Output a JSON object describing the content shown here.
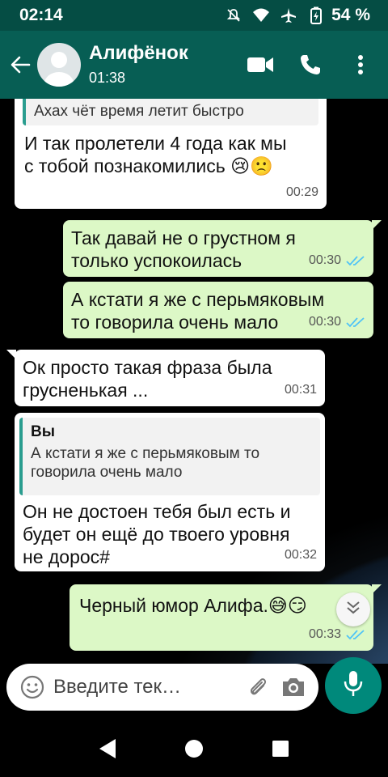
{
  "status_bar": {
    "time": "02:14",
    "battery": "54 %",
    "icons": [
      "mute-icon",
      "wifi-icon",
      "airplane-icon",
      "battery-icon"
    ]
  },
  "header": {
    "contact_name": "Алифёнок",
    "last_seen": "01:38",
    "icons": [
      "back-arrow-icon",
      "video-call-icon",
      "phone-icon",
      "more-vert-icon"
    ]
  },
  "messages": [
    {
      "direction": "in",
      "quote_text": "Ахах чёт время летит быстро",
      "line1": "И так пролетели 4 года как мы",
      "line2": "с тобой познакомились",
      "emoji": "😢🙁",
      "time": "00:29"
    },
    {
      "direction": "out",
      "line1": "Так давай не о грустном я",
      "line2": "только успокоилась",
      "time": "00:30",
      "status": "read"
    },
    {
      "direction": "out",
      "line1": "А кстати я же с перьмяковым",
      "line2": "то говорила очень мало",
      "time": "00:30",
      "status": "read"
    },
    {
      "direction": "in",
      "line1": "Ок просто такая фраза была",
      "line2": "грусненькая ...",
      "time": "00:31"
    },
    {
      "direction": "in",
      "quote_author": "Вы",
      "quote_line1": "А кстати я же с перьмяковым то",
      "quote_line2": "говорила очень мало",
      "line1": "Он не достоен тебя был есть и",
      "line2": "будет он ещё до твоего уровня",
      "line3": "не дорос#",
      "time": "00:32"
    },
    {
      "direction": "out",
      "line1": "Черный юмор Алифа.",
      "emoji": "😅😏",
      "time": "00:33",
      "status": "read"
    }
  ],
  "input": {
    "placeholder": "Введите тек…",
    "icons": [
      "emoji-icon",
      "attach-icon",
      "camera-icon",
      "mic-icon"
    ]
  },
  "navigation": {
    "icons": [
      "back-triangle-icon",
      "home-circle-icon",
      "recents-square-icon"
    ]
  },
  "colors": {
    "header": "#075e54",
    "status_bar": "#054d44",
    "outgoing_bubble": "#dcf8c6",
    "incoming_bubble": "#ffffff",
    "read_ticks": "#4fc3f7",
    "mic_button": "#00897b"
  }
}
